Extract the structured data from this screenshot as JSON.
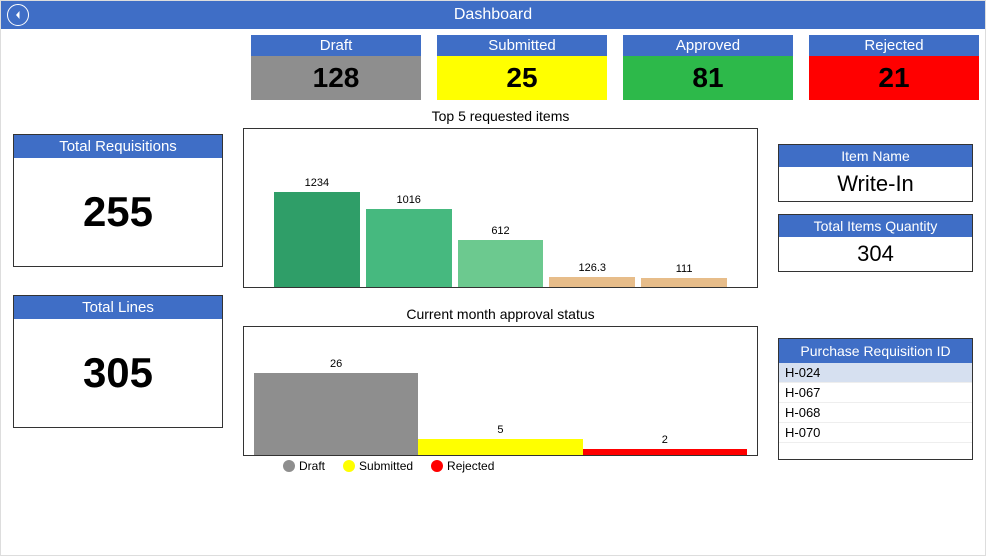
{
  "header": {
    "title": "Dashboard"
  },
  "status_cards": {
    "draft": {
      "label": "Draft",
      "value": "128"
    },
    "submitted": {
      "label": "Submitted",
      "value": "25"
    },
    "approved": {
      "label": "Approved",
      "value": "81"
    },
    "rejected": {
      "label": "Rejected",
      "value": "21"
    }
  },
  "kpi": {
    "total_requisitions": {
      "label": "Total Requisitions",
      "value": "255"
    },
    "total_lines": {
      "label": "Total Lines",
      "value": "305"
    },
    "item_name": {
      "label": "Item Name",
      "value": "Write-In"
    },
    "total_items_qty": {
      "label": "Total Items Quantity",
      "value": "304"
    }
  },
  "chart1_title": "Top 5 requested items",
  "chart2_title": "Current month approval status",
  "legend": {
    "draft": "Draft",
    "submitted": "Submitted",
    "rejected": "Rejected"
  },
  "pr_list": {
    "header": "Purchase Requisition ID",
    "items": [
      "H-024",
      "H-067",
      "H-068",
      "H-070"
    ]
  },
  "chart_data": [
    {
      "type": "bar",
      "title": "Top 5 requested items",
      "categories": [
        "",
        "",
        "",
        "",
        ""
      ],
      "values": [
        1234,
        1016,
        612,
        126.3,
        111
      ],
      "colors": [
        "#2f9e68",
        "#46b97f",
        "#6cc98f",
        "#e7bd8a",
        "#e7bd8a"
      ],
      "ylim": [
        0,
        1300
      ]
    },
    {
      "type": "bar",
      "title": "Current month approval status",
      "categories": [
        "Draft",
        "Submitted",
        "Rejected"
      ],
      "values": [
        26,
        5,
        2
      ],
      "colors": [
        "#8e8e8e",
        "#ffff00",
        "#ff0000"
      ],
      "ylim": [
        0,
        30
      ]
    }
  ]
}
